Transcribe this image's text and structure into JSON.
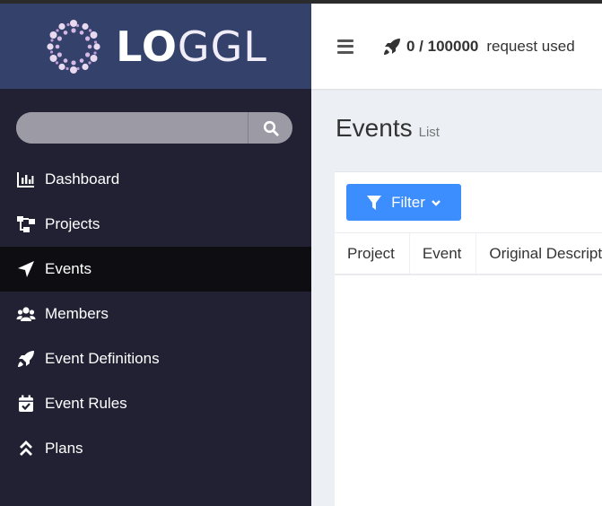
{
  "brand": {
    "logo_lo": "LO",
    "logo_ggl": "GGL"
  },
  "search": {
    "placeholder": "",
    "value": ""
  },
  "sidebar": {
    "items": [
      {
        "label": "Dashboard",
        "icon": "chart-bar-icon",
        "active": false
      },
      {
        "label": "Projects",
        "icon": "sitemap-icon",
        "active": false
      },
      {
        "label": "Events",
        "icon": "paper-plane-icon",
        "active": true
      },
      {
        "label": "Members",
        "icon": "users-icon",
        "active": false
      },
      {
        "label": "Event Definitions",
        "icon": "rocket-icon",
        "active": false
      },
      {
        "label": "Event Rules",
        "icon": "calendar-check-icon",
        "active": false
      },
      {
        "label": "Plans",
        "icon": "chevrons-up-icon",
        "active": false
      }
    ]
  },
  "topbar": {
    "request_count": "0 / 100000",
    "request_label": "request used"
  },
  "page": {
    "title": "Events",
    "subtitle": "List"
  },
  "filter": {
    "label": "Filter"
  },
  "table": {
    "columns": [
      "Project",
      "Event",
      "Original Description"
    ]
  },
  "colors": {
    "sidebar": "#222033",
    "brand": "#34426b",
    "accent": "#3c8dfe",
    "active": "#0e0d12"
  }
}
